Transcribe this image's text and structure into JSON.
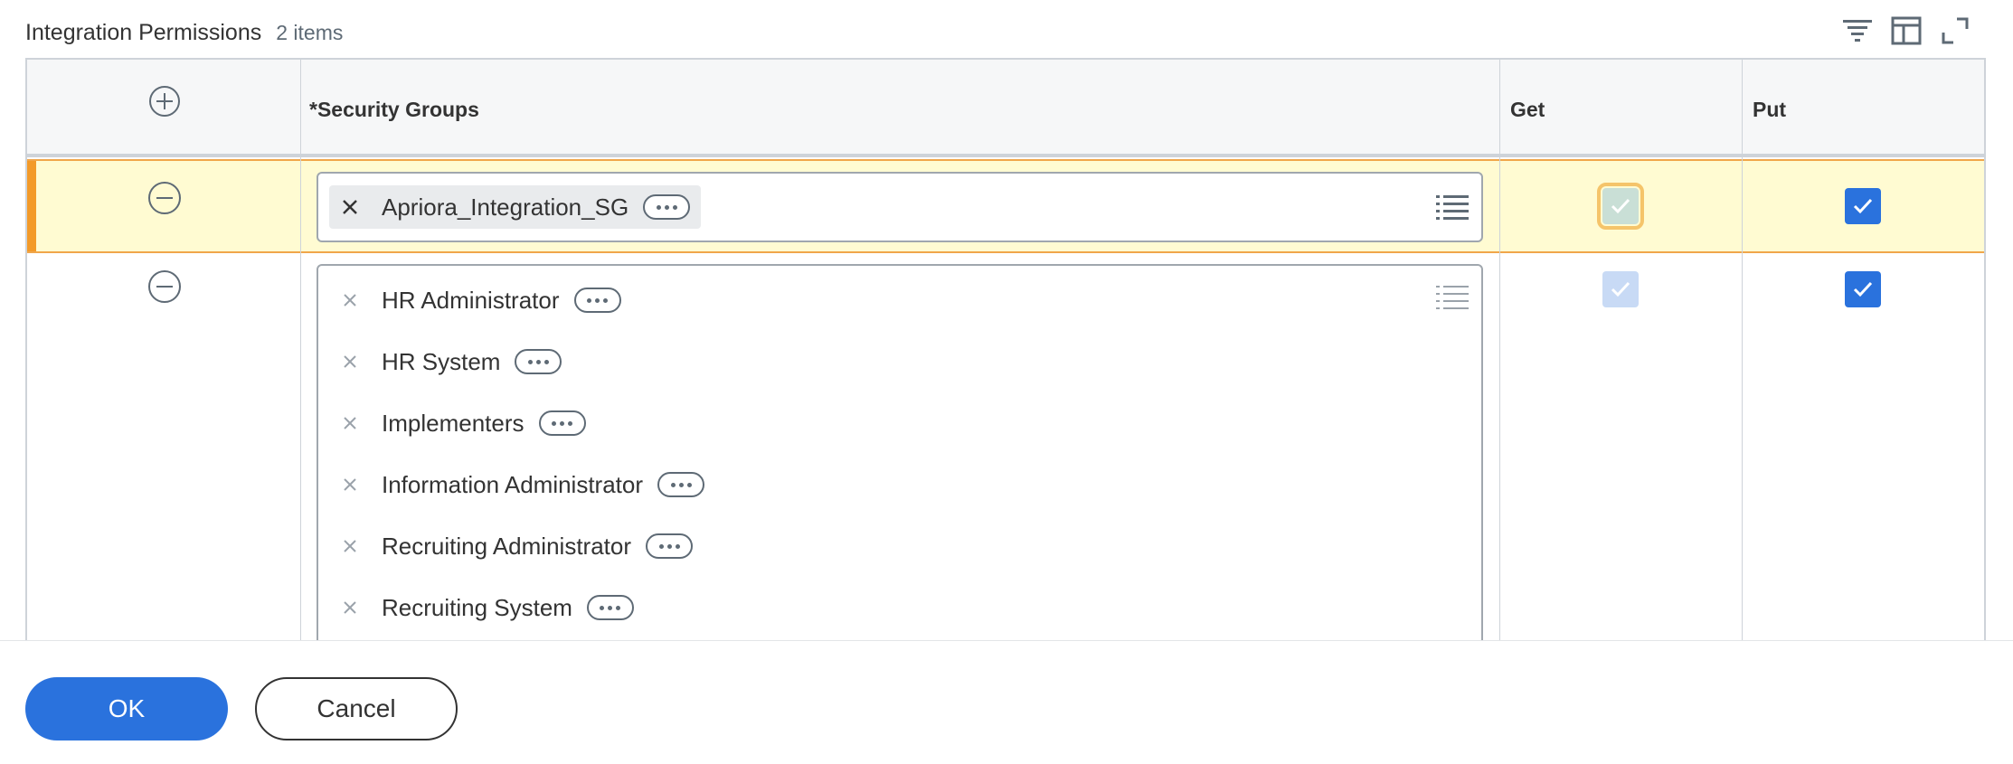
{
  "header": {
    "title": "Integration Permissions",
    "count": "2 items",
    "tools": [
      "filter-icon",
      "columns-icon",
      "expand-icon"
    ]
  },
  "table": {
    "columns": {
      "security_groups": "*Security Groups",
      "get": "Get",
      "put": "Put"
    },
    "rows": [
      {
        "groups": [
          "Apriora_Integration_SG"
        ],
        "get": {
          "checked": true,
          "disabled": true
        },
        "put": {
          "checked": true,
          "disabled": false
        },
        "selected": true
      },
      {
        "groups": [
          "HR Administrator",
          "HR System",
          "Implementers",
          "Information Administrator",
          "Recruiting Administrator",
          "Recruiting System"
        ],
        "get": {
          "checked": true,
          "disabled": true
        },
        "put": {
          "checked": true,
          "disabled": false
        },
        "selected": false
      }
    ]
  },
  "footer": {
    "ok_label": "OK",
    "cancel_label": "Cancel"
  },
  "colors": {
    "accent": "#2a72dd",
    "selected_row": "#fffbd2",
    "selected_row_border": "#f0a64a"
  }
}
